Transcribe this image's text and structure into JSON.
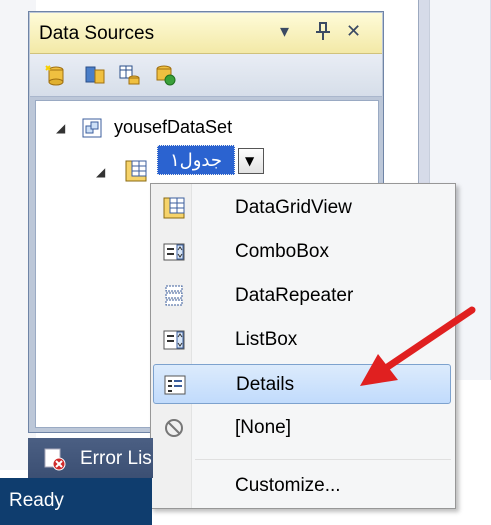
{
  "panel": {
    "title": "Data Sources",
    "pin_glyph": "↕",
    "dropdown_glyph": "▾",
    "close_glyph": "✕",
    "toolbar_icons": [
      "add-data-source-icon",
      "edit-dataset-icon",
      "configure-dataset-icon",
      "refresh-icon"
    ]
  },
  "tree": {
    "dataset_label": "yousefDataSet",
    "table_label": "جدول۱",
    "expander_glyph": "◢",
    "dropdown_glyph": "▼"
  },
  "context_menu": {
    "items": [
      {
        "label": "DataGridView",
        "icon": "datagridview-icon"
      },
      {
        "label": "ComboBox",
        "icon": "combobox-icon"
      },
      {
        "label": "DataRepeater",
        "icon": "datarepeater-icon"
      },
      {
        "label": "ListBox",
        "icon": "listbox-icon"
      },
      {
        "label": "Details",
        "icon": "details-icon",
        "highlighted": true
      },
      {
        "label": "[None]",
        "icon": "none-icon"
      },
      {
        "label": "Customize...",
        "icon": ""
      }
    ]
  },
  "bottom": {
    "error_tab_label": "Error Lis",
    "status_text": "Ready"
  },
  "colors": {
    "highlight": "#c1dbfc",
    "selection": "#2b63d0",
    "arrow": "#e02020",
    "title_bg": "#f3e9a7"
  }
}
